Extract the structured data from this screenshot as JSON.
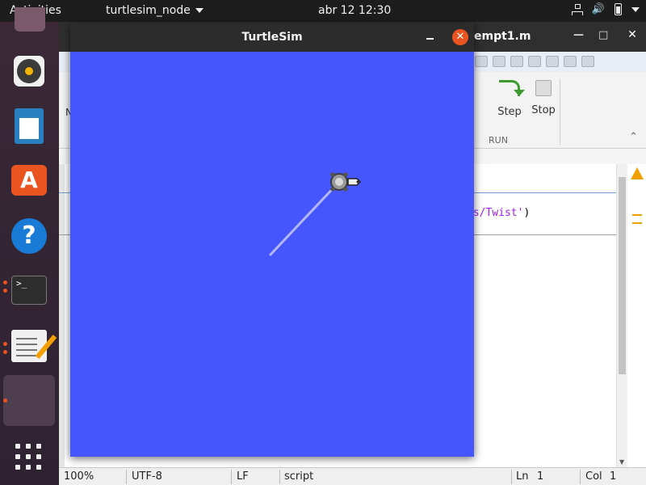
{
  "topbar": {
    "activities": "Activities",
    "app_menu": "turtlesim_node",
    "clock": "abr 12  12:30"
  },
  "dock": {
    "terminal_prompt": ">_"
  },
  "background_window": {
    "title": "empt1.m",
    "ribbon": {
      "step_label": "Step",
      "stop_label": "Stop",
      "run_section": "RUN",
      "left_label": "N"
    },
    "code_snippet": "gs/Twist'",
    "code_paren": ")"
  },
  "statusbar": {
    "zoom": "100%",
    "encoding": "UTF-8",
    "line_ending": "LF",
    "mode": "script",
    "ln_label": "Ln",
    "ln_value": "1",
    "col_label": "Col",
    "col_value": "1"
  },
  "turtlesim": {
    "title": "TurtleSim",
    "background_color": "#4556ff",
    "pen_color": "#b3b8ff",
    "path": [
      [
        335,
        315
      ],
      [
        420,
        225
      ]
    ]
  },
  "colors": {
    "accent": "#e95420"
  }
}
